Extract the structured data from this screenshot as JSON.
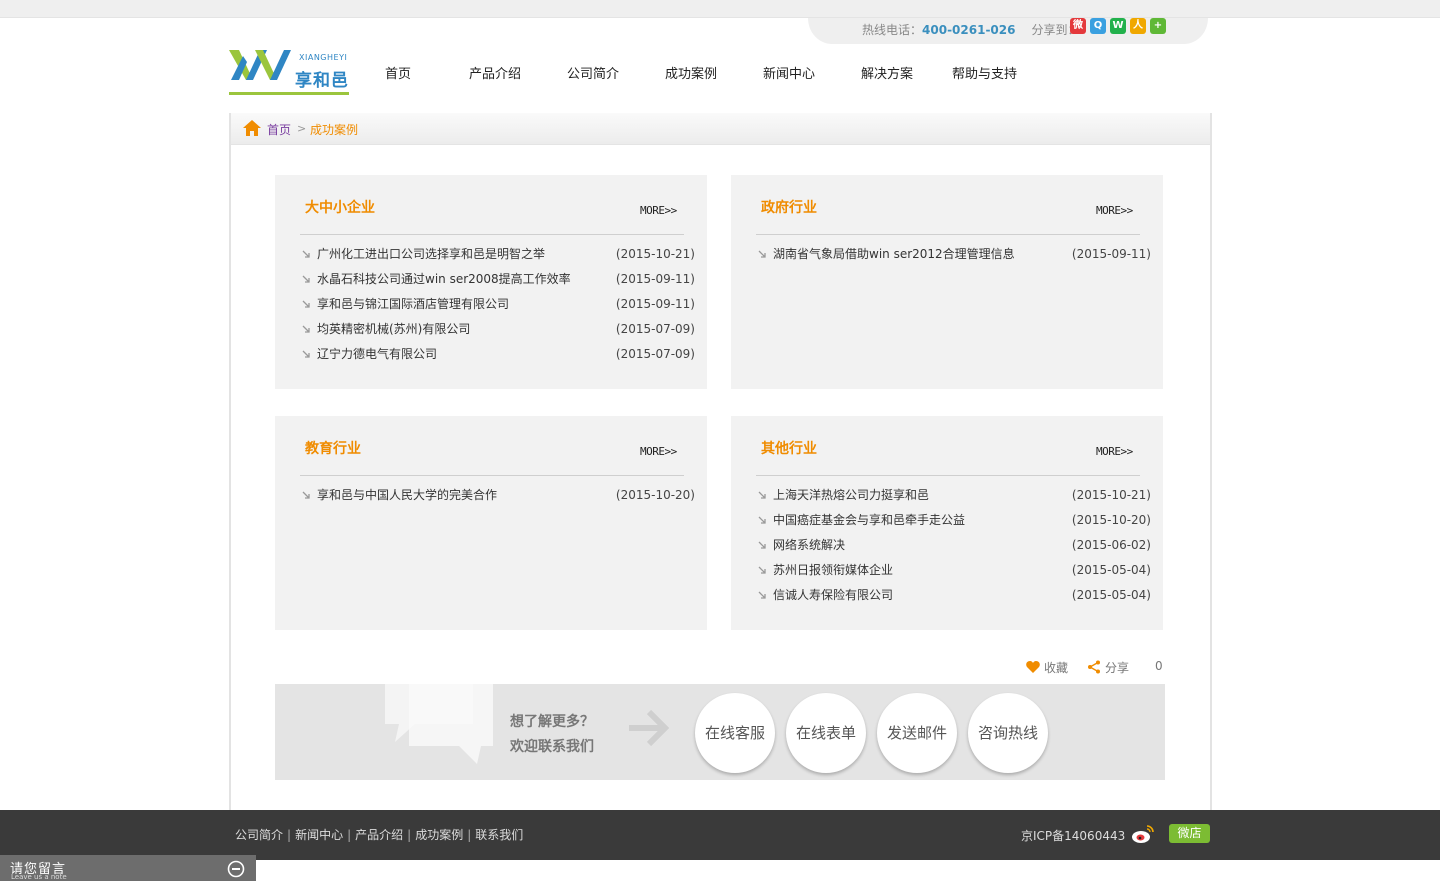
{
  "header": {
    "hotline_label": "热线电话：",
    "hotline_number": "400-0261-026",
    "share_label": "分享到：",
    "share_icons": [
      "weibo-icon",
      "qq-weibo-icon",
      "wechat-icon",
      "renren-icon",
      "more-share-icon"
    ]
  },
  "logo": {
    "cn": "享和邑",
    "en": "XIANGHEYI"
  },
  "nav": [
    "首页",
    "产品介绍",
    "公司简介",
    "成功案例",
    "新闻中心",
    "解决方案",
    "帮助与支持"
  ],
  "breadcrumb": {
    "home": "首页",
    "separator": ">",
    "current": "成功案例"
  },
  "panels": [
    {
      "title": "大中小企业",
      "more": "MORE>>",
      "items": [
        {
          "title": "广州化工进出口公司选择享和邑是明智之举",
          "date": "(2015-10-21)"
        },
        {
          "title": "水晶石科技公司通过win ser2008提高工作效率",
          "date": "(2015-09-11)"
        },
        {
          "title": "享和邑与锦江国际酒店管理有限公司",
          "date": "(2015-09-11)"
        },
        {
          "title": "均英精密机械(苏州)有限公司",
          "date": "(2015-07-09)"
        },
        {
          "title": "辽宁力德电气有限公司",
          "date": "(2015-07-09)"
        }
      ]
    },
    {
      "title": "政府行业",
      "more": "MORE>>",
      "items": [
        {
          "title": "湖南省气象局借助win ser2012合理管理信息",
          "date": "(2015-09-11)"
        }
      ]
    },
    {
      "title": "教育行业",
      "more": "MORE>>",
      "items": [
        {
          "title": "享和邑与中国人民大学的完美合作",
          "date": "(2015-10-20)"
        }
      ]
    },
    {
      "title": "其他行业",
      "more": "MORE>>",
      "items": [
        {
          "title": "上海天洋热熔公司力挺享和邑",
          "date": "(2015-10-21)"
        },
        {
          "title": "中国癌症基金会与享和邑牵手走公益",
          "date": "(2015-10-20)"
        },
        {
          "title": "网络系统解决",
          "date": "(2015-06-02)"
        },
        {
          "title": "苏州日报领衔媒体企业",
          "date": "(2015-05-04)"
        },
        {
          "title": "信诚人寿保险有限公司",
          "date": "(2015-05-04)"
        }
      ]
    }
  ],
  "actions": {
    "favorite": "收藏",
    "share": "分享",
    "count": "0"
  },
  "contact": {
    "line1": "想了解更多？",
    "line2": "欢迎联系我们",
    "buttons": [
      "在线客服",
      "在线表单",
      "发送邮件",
      "咨询热线"
    ]
  },
  "footer": {
    "links": [
      "公司简介",
      "新闻中心",
      "产品介绍",
      "成功案例",
      "联系我们"
    ],
    "icp": "京ICP备14060443",
    "weidian": "微店"
  },
  "note": {
    "cn": "请您留言",
    "en": "Leave us a note"
  },
  "colors": {
    "accent": "#f08c00",
    "brand_blue": "#2f86c4",
    "brand_green": "#9bc53d",
    "footer_bg": "#3a3a3a"
  }
}
